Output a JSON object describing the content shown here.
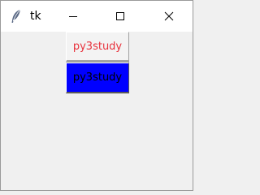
{
  "window": {
    "title": "tk",
    "icons": {
      "app": "feather-icon",
      "minimize": "minimize-icon",
      "maximize": "maximize-icon",
      "close": "close-icon"
    }
  },
  "buttons": [
    {
      "label": "py3study",
      "fg": "#e8323c",
      "bg": "#f3f3f3"
    },
    {
      "label": "py3study",
      "fg": "#000000",
      "bg": "#0000ff"
    }
  ]
}
